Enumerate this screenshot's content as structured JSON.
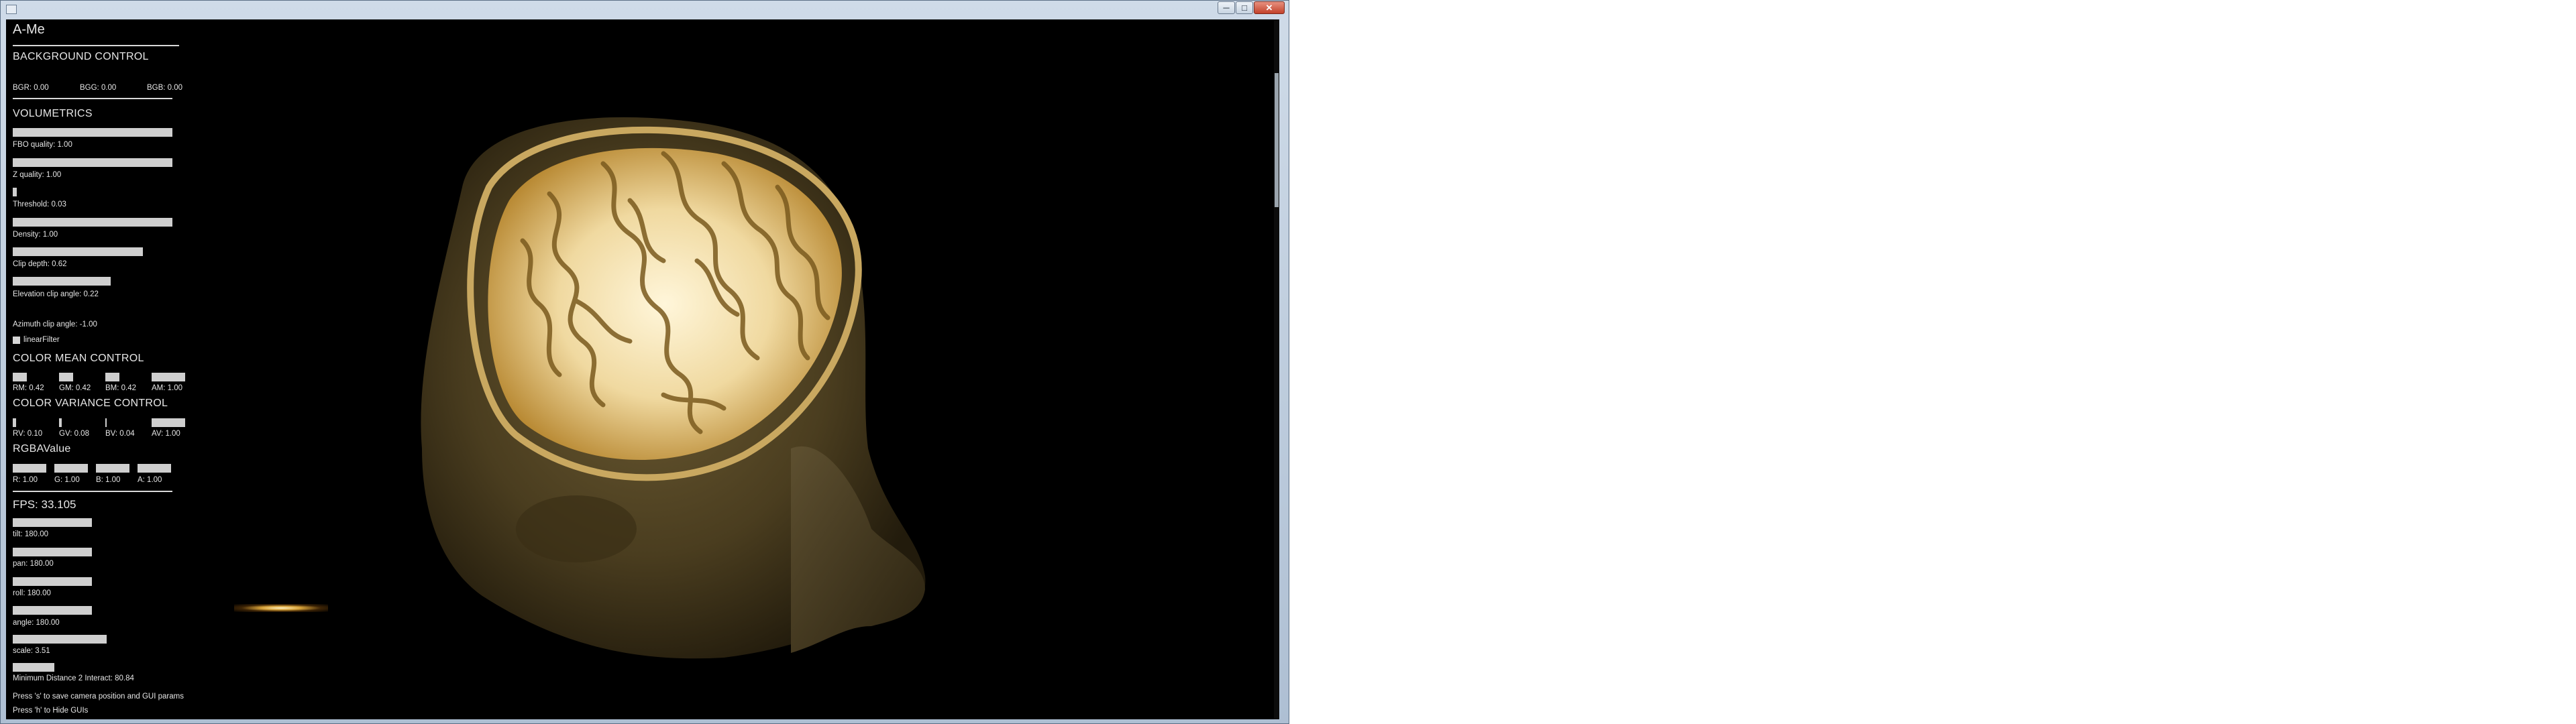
{
  "window": {
    "title": "A-Me",
    "min_glyph": "─",
    "max_glyph": "□",
    "close_glyph": "✕"
  },
  "background_control": {
    "heading": "BACKGROUND CONTROL",
    "bgr": "BGR: 0.00",
    "bgg": "BGG: 0.00",
    "bgb": "BGB: 0.00"
  },
  "volumetrics": {
    "heading": "VOLUMETRICS",
    "sliders": [
      {
        "label": "FBO quality: 1.00",
        "value": 1.0
      },
      {
        "label": "Z quality: 1.00",
        "value": 1.0
      },
      {
        "label": "Threshold: 0.03",
        "value": 0.03
      },
      {
        "label": "Density: 1.00",
        "value": 1.0
      },
      {
        "label": "Clip depth: 0.62",
        "value": 0.62
      },
      {
        "label": "Elevation clip angle: 0.22",
        "value": 0.22
      },
      {
        "label": "Azimuth clip angle: -1.00",
        "value": -1.0
      }
    ],
    "linear_filter": {
      "label": "linearFilter",
      "checked": false
    }
  },
  "color_mean": {
    "heading": "COLOR MEAN CONTROL",
    "items": [
      {
        "label": "RM: 0.42",
        "value": 0.42
      },
      {
        "label": "GM: 0.42",
        "value": 0.42
      },
      {
        "label": "BM: 0.42",
        "value": 0.42
      },
      {
        "label": "AM: 1.00",
        "value": 1.0
      }
    ]
  },
  "color_variance": {
    "heading": "COLOR VARIANCE CONTROL",
    "items": [
      {
        "label": "RV: 0.10",
        "value": 0.1
      },
      {
        "label": "GV: 0.08",
        "value": 0.08
      },
      {
        "label": "BV: 0.04",
        "value": 0.04
      },
      {
        "label": "AV: 1.00",
        "value": 1.0
      }
    ]
  },
  "rgba_value": {
    "heading": "RGBAValue",
    "items": [
      {
        "label": "R: 1.00",
        "value": 1.0
      },
      {
        "label": "G: 1.00",
        "value": 1.0
      },
      {
        "label": "B: 1.00",
        "value": 1.0
      },
      {
        "label": "A: 1.00",
        "value": 1.0
      }
    ]
  },
  "fps": "FPS: 33.105",
  "camera": [
    {
      "label": "tilt: 180.00",
      "value": 180.0
    },
    {
      "label": "pan: 180.00",
      "value": 180.0
    },
    {
      "label": "roll: 180.00",
      "value": 180.0
    },
    {
      "label": "angle: 180.00",
      "value": 180.0
    },
    {
      "label": "scale: 3.51",
      "value": 3.51
    }
  ],
  "info": [
    "Minimum Distance 2 Interact: 80.84",
    "Press 's' to save camera position and GUI params",
    "Press 'h' to Hide GUIs"
  ],
  "colors": {
    "accent": "#d9a43a",
    "panel_text": "#e6e6e6",
    "bar": "#cfcfcf",
    "background": "#000000"
  }
}
